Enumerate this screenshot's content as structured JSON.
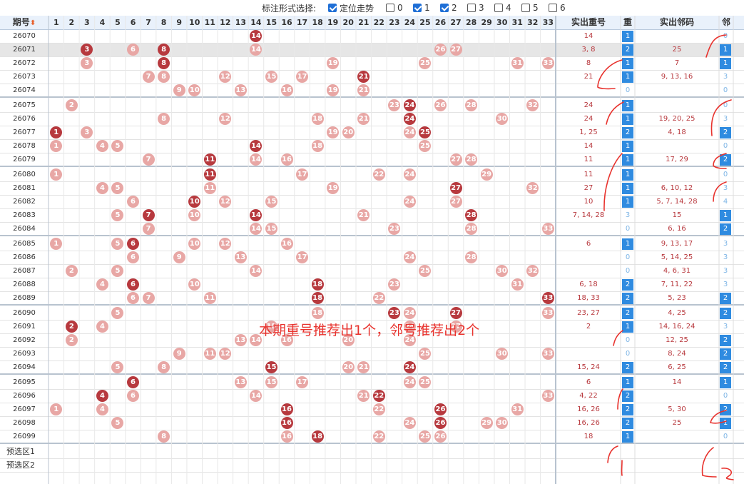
{
  "toolbar": {
    "label": "标注形式选择:",
    "options": [
      {
        "label": "定位走势",
        "checked": true
      },
      {
        "label": "0",
        "checked": false
      },
      {
        "label": "1",
        "checked": true
      },
      {
        "label": "2",
        "checked": true
      },
      {
        "label": "3",
        "checked": false
      },
      {
        "label": "4",
        "checked": false
      },
      {
        "label": "5",
        "checked": false
      },
      {
        "label": "6",
        "checked": false
      }
    ]
  },
  "header": {
    "period": "期号",
    "sort_icon": "sort-arrows-icon",
    "numbers": [
      "1",
      "2",
      "3",
      "4",
      "5",
      "6",
      "7",
      "8",
      "9",
      "10",
      "11",
      "12",
      "13",
      "14",
      "15",
      "16",
      "17",
      "18",
      "19",
      "20",
      "21",
      "22",
      "23",
      "24",
      "25",
      "26",
      "27",
      "28",
      "29",
      "30",
      "31",
      "32",
      "33"
    ],
    "repeat_out": "实出重号",
    "repeat": "重",
    "neighbor_out": "实出邻码",
    "neighbor": "邻"
  },
  "colors": {
    "ball_normal": "#e8a7a5",
    "ball_highlight": "#b7393e",
    "box_blue": "#2f8be0",
    "annotation": "#e8322d"
  },
  "chart_data": {
    "type": "table",
    "rows": [
      {
        "period": "26070",
        "balls": [
          14
        ],
        "red": [
          14
        ],
        "repeat_out": "14",
        "repeat": "1",
        "repeat_on": true,
        "neighbor_out": "",
        "neighbor": "0",
        "neighbor_on": false
      },
      {
        "period": "26071",
        "balls": [
          3,
          6,
          8,
          14,
          26,
          27
        ],
        "red": [
          3,
          8
        ],
        "repeat_out": "3, 8",
        "repeat": "2",
        "repeat_on": true,
        "neighbor_out": "25",
        "neighbor": "1",
        "neighbor_on": true
      },
      {
        "period": "26072",
        "balls": [
          3,
          8,
          19,
          25,
          31,
          33
        ],
        "red": [
          8
        ],
        "repeat_out": "8",
        "repeat": "1",
        "repeat_on": true,
        "neighbor_out": "7",
        "neighbor": "1",
        "neighbor_on": true
      },
      {
        "period": "26073",
        "balls": [
          7,
          8,
          12,
          15,
          17,
          21
        ],
        "red": [
          21
        ],
        "repeat_out": "21",
        "repeat": "1",
        "repeat_on": true,
        "neighbor_out": "9, 13, 16",
        "neighbor": "3",
        "neighbor_on": false
      },
      {
        "period": "26074",
        "balls": [
          9,
          10,
          13,
          16,
          19,
          21
        ],
        "red": [],
        "repeat_out": "",
        "repeat": "0",
        "repeat_on": false,
        "neighbor_out": "",
        "neighbor": "0",
        "neighbor_on": false
      },
      {
        "period": "26075",
        "balls": [
          2,
          23,
          24,
          26,
          28,
          32
        ],
        "red": [
          24
        ],
        "repeat_out": "24",
        "repeat": "1",
        "repeat_on": true,
        "neighbor_out": "",
        "neighbor": "0",
        "neighbor_on": false
      },
      {
        "period": "26076",
        "balls": [
          8,
          12,
          18,
          21,
          24,
          30
        ],
        "red": [
          24
        ],
        "repeat_out": "24",
        "repeat": "1",
        "repeat_on": true,
        "neighbor_out": "19, 20, 25",
        "neighbor": "3",
        "neighbor_on": false
      },
      {
        "period": "26077",
        "balls": [
          1,
          3,
          19,
          20,
          24,
          25
        ],
        "red": [
          1,
          25
        ],
        "repeat_out": "1, 25",
        "repeat": "2",
        "repeat_on": true,
        "neighbor_out": "4, 18",
        "neighbor": "2",
        "neighbor_on": true
      },
      {
        "period": "26078",
        "balls": [
          1,
          4,
          5,
          14,
          18,
          25
        ],
        "red": [
          14
        ],
        "repeat_out": "14",
        "repeat": "1",
        "repeat_on": true,
        "neighbor_out": "",
        "neighbor": "0",
        "neighbor_on": false
      },
      {
        "period": "26079",
        "balls": [
          7,
          11,
          14,
          16,
          27,
          28
        ],
        "red": [
          11
        ],
        "repeat_out": "11",
        "repeat": "1",
        "repeat_on": true,
        "neighbor_out": "17, 29",
        "neighbor": "2",
        "neighbor_on": true
      },
      {
        "period": "26080",
        "balls": [
          1,
          11,
          17,
          22,
          24,
          29
        ],
        "red": [
          11
        ],
        "repeat_out": "11",
        "repeat": "1",
        "repeat_on": true,
        "neighbor_out": "",
        "neighbor": "0",
        "neighbor_on": false
      },
      {
        "period": "26081",
        "balls": [
          4,
          5,
          11,
          19,
          27,
          32
        ],
        "red": [
          27
        ],
        "repeat_out": "27",
        "repeat": "1",
        "repeat_on": true,
        "neighbor_out": "6, 10, 12",
        "neighbor": "3",
        "neighbor_on": false
      },
      {
        "period": "26082",
        "balls": [
          6,
          10,
          12,
          15,
          24,
          27
        ],
        "red": [
          10
        ],
        "repeat_out": "10",
        "repeat": "1",
        "repeat_on": true,
        "neighbor_out": "5, 7, 14, 28",
        "neighbor": "4",
        "neighbor_on": false
      },
      {
        "period": "26083",
        "balls": [
          5,
          7,
          10,
          14,
          21,
          28
        ],
        "red": [
          7,
          14,
          28
        ],
        "repeat_out": "7, 14, 28",
        "repeat": "3",
        "repeat_on": false,
        "neighbor_out": "15",
        "neighbor": "1",
        "neighbor_on": true
      },
      {
        "period": "26084",
        "balls": [
          7,
          14,
          15,
          23,
          28,
          33
        ],
        "red": [],
        "repeat_out": "",
        "repeat": "0",
        "repeat_on": false,
        "neighbor_out": "6, 16",
        "neighbor": "2",
        "neighbor_on": true
      },
      {
        "period": "26085",
        "balls": [
          1,
          5,
          6,
          10,
          12,
          16
        ],
        "red": [
          6
        ],
        "repeat_out": "6",
        "repeat": "1",
        "repeat_on": true,
        "neighbor_out": "9, 13, 17",
        "neighbor": "3",
        "neighbor_on": false
      },
      {
        "period": "26086",
        "balls": [
          6,
          9,
          13,
          17,
          24,
          28
        ],
        "red": [],
        "repeat_out": "",
        "repeat": "0",
        "repeat_on": false,
        "neighbor_out": "5, 14, 25",
        "neighbor": "3",
        "neighbor_on": false
      },
      {
        "period": "26087",
        "balls": [
          2,
          5,
          14,
          25,
          30,
          32
        ],
        "red": [],
        "repeat_out": "",
        "repeat": "0",
        "repeat_on": false,
        "neighbor_out": "4, 6, 31",
        "neighbor": "3",
        "neighbor_on": false
      },
      {
        "period": "26088",
        "balls": [
          4,
          6,
          10,
          18,
          23,
          31
        ],
        "red": [
          6,
          18
        ],
        "repeat_out": "6, 18",
        "repeat": "2",
        "repeat_on": true,
        "neighbor_out": "7, 11, 22",
        "neighbor": "3",
        "neighbor_on": false
      },
      {
        "period": "26089",
        "balls": [
          6,
          7,
          11,
          18,
          22,
          33
        ],
        "red": [
          18,
          33
        ],
        "repeat_out": "18, 33",
        "repeat": "2",
        "repeat_on": true,
        "neighbor_out": "5, 23",
        "neighbor": "2",
        "neighbor_on": true
      },
      {
        "period": "26090",
        "balls": [
          5,
          18,
          23,
          24,
          27,
          33
        ],
        "red": [
          23,
          27
        ],
        "repeat_out": "23, 27",
        "repeat": "2",
        "repeat_on": true,
        "neighbor_out": "4, 25",
        "neighbor": "2",
        "neighbor_on": true
      },
      {
        "period": "26091",
        "balls": [
          2,
          4,
          15,
          24,
          27
        ],
        "red": [
          2
        ],
        "repeat_out": "2",
        "repeat": "1",
        "repeat_on": true,
        "neighbor_out": "14, 16, 24",
        "neighbor": "3",
        "neighbor_on": false
      },
      {
        "period": "26092",
        "balls": [
          2,
          13,
          14,
          16,
          20,
          24
        ],
        "red": [],
        "repeat_out": "",
        "repeat": "0",
        "repeat_on": false,
        "neighbor_out": "12, 25",
        "neighbor": "2",
        "neighbor_on": true
      },
      {
        "period": "26093",
        "balls": [
          9,
          11,
          12,
          25,
          30,
          33
        ],
        "red": [],
        "repeat_out": "",
        "repeat": "0",
        "repeat_on": false,
        "neighbor_out": "8, 24",
        "neighbor": "2",
        "neighbor_on": true
      },
      {
        "period": "26094",
        "balls": [
          5,
          8,
          15,
          20,
          21,
          24
        ],
        "red": [
          15,
          24
        ],
        "repeat_out": "15, 24",
        "repeat": "2",
        "repeat_on": true,
        "neighbor_out": "6, 25",
        "neighbor": "2",
        "neighbor_on": true
      },
      {
        "period": "26095",
        "balls": [
          6,
          13,
          15,
          17,
          24,
          25
        ],
        "red": [
          6
        ],
        "repeat_out": "6",
        "repeat": "1",
        "repeat_on": true,
        "neighbor_out": "14",
        "neighbor": "1",
        "neighbor_on": true
      },
      {
        "period": "26096",
        "balls": [
          4,
          6,
          14,
          21,
          22,
          33
        ],
        "red": [
          4,
          22
        ],
        "repeat_out": "4, 22",
        "repeat": "2",
        "repeat_on": true,
        "neighbor_out": "",
        "neighbor": "0",
        "neighbor_on": false
      },
      {
        "period": "26097",
        "balls": [
          1,
          4,
          16,
          22,
          26,
          31
        ],
        "red": [
          16,
          26
        ],
        "repeat_out": "16, 26",
        "repeat": "2",
        "repeat_on": true,
        "neighbor_out": "5, 30",
        "neighbor": "2",
        "neighbor_on": true
      },
      {
        "period": "26098",
        "balls": [
          5,
          16,
          24,
          26,
          29,
          30
        ],
        "red": [
          16,
          26
        ],
        "repeat_out": "16, 26",
        "repeat": "2",
        "repeat_on": true,
        "neighbor_out": "25",
        "neighbor": "1",
        "neighbor_on": true
      },
      {
        "period": "26099",
        "balls": [
          8,
          16,
          18,
          22,
          25,
          26
        ],
        "red": [
          18
        ],
        "repeat_out": "18",
        "repeat": "1",
        "repeat_on": true,
        "neighbor_out": "",
        "neighbor": "0",
        "neighbor_on": false
      }
    ],
    "presets": [
      "预选区1",
      "预选区2"
    ]
  },
  "annotation": "本期重号推荐出1个，邻号推荐出2个"
}
